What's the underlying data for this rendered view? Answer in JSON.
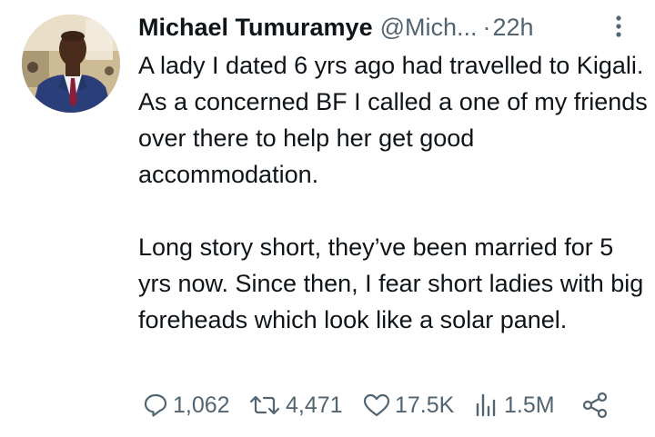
{
  "tweet": {
    "author": {
      "name": "Michael Tumuramye",
      "handle": "@Mich...",
      "separator": "·",
      "time": "22h"
    },
    "paragraphs": [
      "A lady I dated 6 yrs ago had travelled to Kigali. As a concerned BF I called a one of my friends over there to help her get good accommodation.",
      "Long story short, they’ve been married for 5 yrs now. Since then, I fear short ladies with big foreheads which look like a solar panel."
    ],
    "actions": {
      "replies": "1,062",
      "reposts": "4,471",
      "likes": "17.5K",
      "views": "1.5M"
    },
    "icons": [
      "more-icon",
      "reply-icon",
      "repost-icon",
      "like-icon",
      "views-icon",
      "share-icon"
    ],
    "colors": {
      "text": "#0f1419",
      "secondary": "#536471",
      "background": "#ffffff"
    }
  }
}
